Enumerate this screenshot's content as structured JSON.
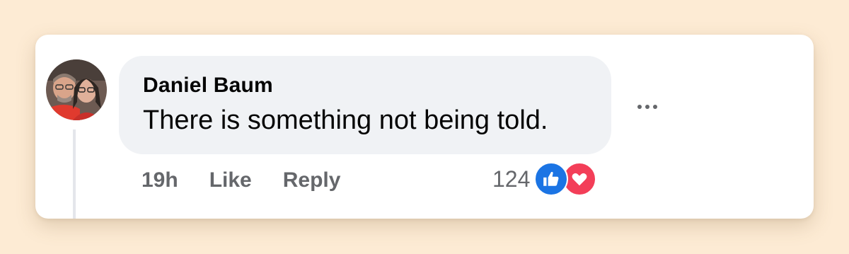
{
  "comment": {
    "author": "Daniel Baum",
    "text": "There is something not being told.",
    "time": "19h",
    "like_label": "Like",
    "reply_label": "Reply",
    "reaction_count": "124",
    "reactions": [
      "like-icon",
      "love-icon"
    ]
  },
  "colors": {
    "page_background": "#fdebd4",
    "bubble": "#f0f2f5",
    "like_blue": "#1b74e4",
    "love_red": "#f33e58",
    "secondary_text": "#65676b"
  }
}
